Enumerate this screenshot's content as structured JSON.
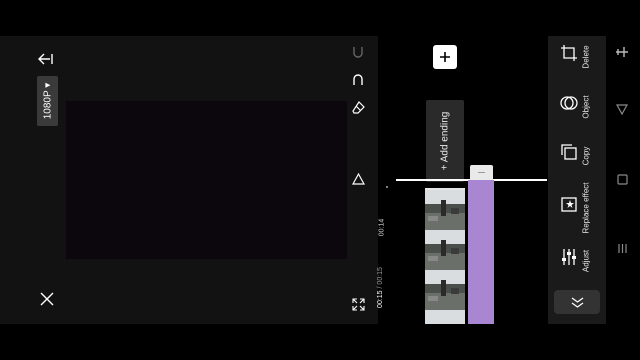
{
  "preview": {
    "resolution_label": "1080P",
    "resolution_caret": "▾"
  },
  "timeline": {
    "add_ending_label": "+ Add ending",
    "time_marker": "00:14",
    "time_current": "00:15",
    "time_separator": " / ",
    "time_total": "00:15"
  },
  "side_panel": {
    "items": [
      {
        "label": "Delete",
        "icon": "crop-icon"
      },
      {
        "label": "Object",
        "icon": "overlap-circles-icon"
      },
      {
        "label": "Copy",
        "icon": "copy-icon"
      },
      {
        "label": "Replace effect",
        "icon": "replace-effect-icon"
      },
      {
        "label": "Adjust",
        "icon": "sliders-icon"
      }
    ]
  },
  "colors": {
    "clip_purple": "#a886d2",
    "panel_bg": "#1a1a1a",
    "editor_bg": "#121212"
  }
}
